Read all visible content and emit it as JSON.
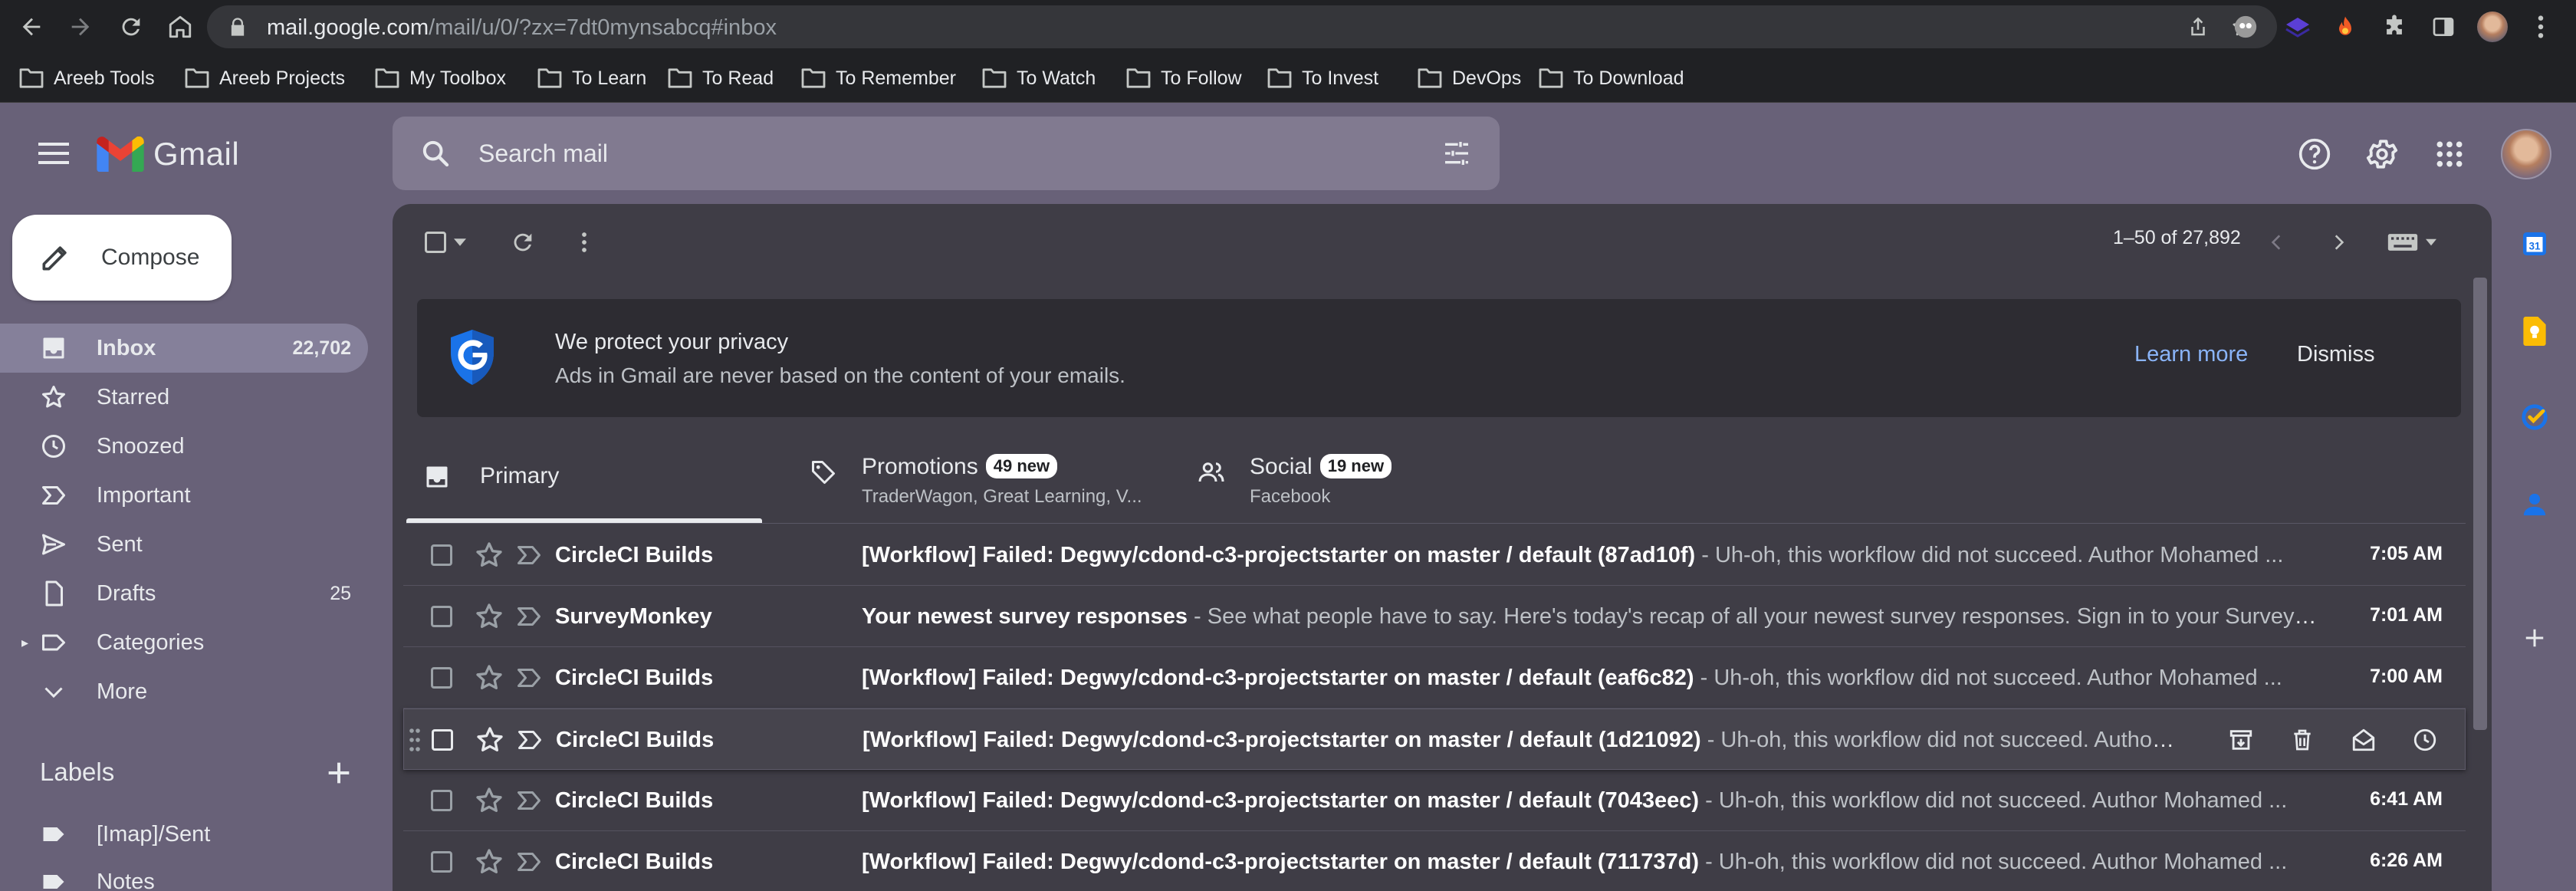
{
  "browser": {
    "url_host": "mail.google.com",
    "url_path": "/mail/u/0/?zx=7dt0mynsabcq#inbox",
    "bookmarks": [
      "Areeb Tools",
      "Areeb Projects",
      "My Toolbox",
      "To Learn",
      "To Read",
      "To Remember",
      "To Watch",
      "To Follow",
      "To Invest",
      "DevOps",
      "To Download"
    ]
  },
  "header": {
    "app_name": "Gmail",
    "search_placeholder": "Search mail"
  },
  "compose": {
    "label": "Compose"
  },
  "nav": [
    {
      "label": "Inbox",
      "count": "22,702",
      "icon": "inbox-icon",
      "active": true
    },
    {
      "label": "Starred",
      "count": "",
      "icon": "star-icon"
    },
    {
      "label": "Snoozed",
      "count": "",
      "icon": "clock-icon"
    },
    {
      "label": "Important",
      "count": "",
      "icon": "important-icon"
    },
    {
      "label": "Sent",
      "count": "",
      "icon": "send-icon"
    },
    {
      "label": "Drafts",
      "count": "25",
      "icon": "draft-icon"
    },
    {
      "label": "Categories",
      "count": "",
      "icon": "label-icon"
    },
    {
      "label": "More",
      "count": "",
      "icon": "chevron-down-icon"
    }
  ],
  "labels": {
    "heading": "Labels",
    "items": [
      "[Imap]/Sent",
      "Notes"
    ]
  },
  "toolbar": {
    "pager": "1–50 of 27,892"
  },
  "privacy": {
    "title": "We protect your privacy",
    "text": "Ads in Gmail are never based on the content of your emails.",
    "learn_more": "Learn more",
    "dismiss": "Dismiss"
  },
  "tabs": {
    "primary": {
      "label": "Primary"
    },
    "promotions": {
      "label": "Promotions",
      "badge": "49 new",
      "sub": "TraderWagon, Great Learning, V..."
    },
    "social": {
      "label": "Social",
      "badge": "19 new",
      "sub": "Facebook"
    }
  },
  "emails": [
    {
      "sender": "CircleCI Builds",
      "subject": "[Workflow] Failed: Degwy/cdond-c3-projectstarter on master / default (87ad10f)",
      "snippet": " - Uh-oh, this workflow did not succeed. Author Mohamed ...",
      "time": "7:05 AM"
    },
    {
      "sender": "SurveyMonkey",
      "subject": "Your newest survey responses",
      "snippet": " - See what people have to say. Here's today's recap of all your newest survey responses. Sign in to your SurveyM...",
      "time": "7:01 AM"
    },
    {
      "sender": "CircleCI Builds",
      "subject": "[Workflow] Failed: Degwy/cdond-c3-projectstarter on master / default (eaf6c82)",
      "snippet": " - Uh-oh, this workflow did not succeed. Author Mohamed ...",
      "time": "7:00 AM"
    },
    {
      "sender": "CircleCI Builds",
      "subject": "[Workflow] Failed: Degwy/cdond-c3-projectstarter on master / default (1d21092)",
      "snippet": " - Uh-oh, this workflow did not succeed. Author ...",
      "time": ""
    },
    {
      "sender": "CircleCI Builds",
      "subject": "[Workflow] Failed: Degwy/cdond-c3-projectstarter on master / default (7043eec)",
      "snippet": " - Uh-oh, this workflow did not succeed. Author Mohamed ...",
      "time": "6:41 AM"
    },
    {
      "sender": "CircleCI Builds",
      "subject": "[Workflow] Failed: Degwy/cdond-c3-projectstarter on master / default (711737d)",
      "snippet": " - Uh-oh, this workflow did not succeed. Author Mohamed ...",
      "time": "6:26 AM"
    }
  ],
  "side_apps": {
    "calendar_day": "31"
  },
  "colors": {
    "gmail_bg": "#686178",
    "panel_bg": "#3f3d46",
    "link_blue": "#8ab4f8",
    "active_nav": "#85809a"
  }
}
